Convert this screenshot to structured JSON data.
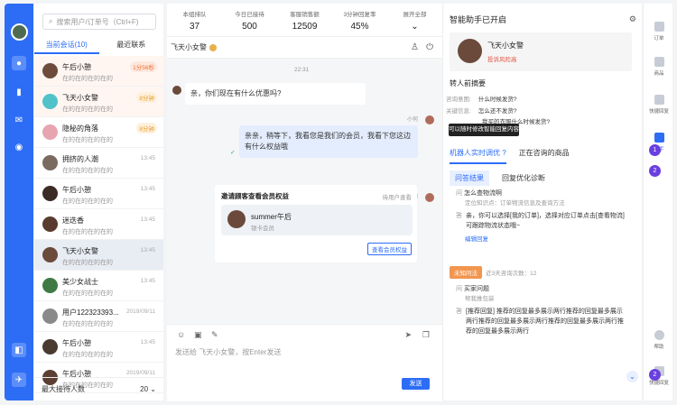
{
  "search": {
    "placeholder": "搜索用户/订单号（Ctrl+F)"
  },
  "tabs": {
    "current": "当前会话(10)",
    "recent": "最近联系"
  },
  "conversations": [
    {
      "name": "午后小憩",
      "preview": "在的在的在的在的",
      "badge": "1分56秒",
      "color": "#6d4c3d"
    },
    {
      "name": "飞天小女警",
      "preview": "在的在的在的在的",
      "badge": "8分钟",
      "color": "#4fc3c9"
    },
    {
      "name": "隐秘的角落",
      "preview": "在的在的在的在的",
      "badge": "8分钟",
      "color": "#e7a5b0"
    },
    {
      "name": "拥挤的人潮",
      "preview": "在的在的在的在的",
      "time": "13:45",
      "color": "#7a6a60"
    },
    {
      "name": "午后小憩",
      "preview": "在的在的在的在的",
      "time": "13:45",
      "color": "#3b2b24"
    },
    {
      "name": "迷迭香",
      "preview": "在的在的在的在的",
      "time": "13:45",
      "color": "#5a3b30"
    },
    {
      "name": "飞天小女警",
      "preview": "在的在的在的在的",
      "time": "13:45",
      "color": "#6b4a3c"
    },
    {
      "name": "美少女战士",
      "preview": "在的在的在的在的",
      "time": "13:45",
      "color": "#3f7a45"
    },
    {
      "name": "用户122323393...",
      "preview": "在的在的在的在的",
      "time": "2019/09/11",
      "color": "#8a8a8a"
    },
    {
      "name": "午后小憩",
      "preview": "在的在的在的在的",
      "time": "13:45",
      "color": "#4a3a30"
    },
    {
      "name": "午后小憩",
      "preview": "在的在的在的在的",
      "time": "2019/09/11",
      "color": "#5b3f32"
    }
  ],
  "list_footer": {
    "label": "最大接待人数",
    "value": "20"
  },
  "stats": [
    {
      "label": "本组排队",
      "value": "37"
    },
    {
      "label": "今日已接待",
      "value": "500"
    },
    {
      "label": "客服销售额",
      "value": "12509"
    },
    {
      "label": "3分钟回复率",
      "value": "45%"
    },
    {
      "label": "展开全部",
      "value": ""
    }
  ],
  "chat": {
    "contact": "飞天小女警",
    "time": "22:31",
    "msg1": "亲，你们现在有什么优惠吗?",
    "agent_name": "小何",
    "msg2": "亲亲，稍等下，我看您是我们的会员，我看下您这边有什么权益哦",
    "agent_name2": "小何",
    "card_title": "邀请顾客查看会员权益",
    "card_status": "待用户查看",
    "card_user": "summer午后",
    "card_level": "银卡会员",
    "card_button": "查看会员权益",
    "input_placeholder": "发送给 飞天小女警，按Enter发送",
    "send": "发送"
  },
  "assistant": {
    "title": "智能助手已开启",
    "profile_name": "飞天小女警",
    "profile_tag": "投诉风险高",
    "summary_title": "转人前摘要",
    "kv": [
      {
        "k": "咨询意图:",
        "v": "什么时候发货?"
      },
      {
        "k": "关键信息:",
        "v": "怎么还不发货?"
      },
      {
        "k": "",
        "v": "我买的衣服什么时候发货?"
      }
    ],
    "tooltip": "可以随时修改智能回复内容",
    "tab_on": "机器人实时调优",
    "tab_off": "正在咨询的商品",
    "sub_on": "问答结果",
    "sub_off": "回复优化诊断",
    "q1": "怎么查物流啊",
    "q1_sub": "定位知识点：订单物流信息及查询方法",
    "a1": "亲，你可以选择[我的订单]，选择对应订单点击[查看物流]可跟踪物流状态哦~",
    "edit": "编辑回复",
    "pill": "未知问法",
    "pill_sub": "近3天咨询次数：12",
    "q2": "买家问题",
    "q2_sub": "帮我推包装",
    "a2": "[推荐回复] 推荐的回复最多展示两行推荐的回复最多展示两行推荐的回复最多展示两行推荐的回复最多展示两行推荐的回复最多展示两行"
  },
  "tools": [
    {
      "label": "订单"
    },
    {
      "label": "商品"
    },
    {
      "label": "快捷回复"
    },
    {
      "label": "助手"
    },
    {
      "label": "帮助"
    },
    {
      "label": "快捷回复"
    }
  ],
  "markers": [
    "1",
    "2",
    "2"
  ],
  "colors": {
    "accent": "#2d6df6",
    "warn": "#f2964f",
    "marker": "#6a3fe0"
  }
}
